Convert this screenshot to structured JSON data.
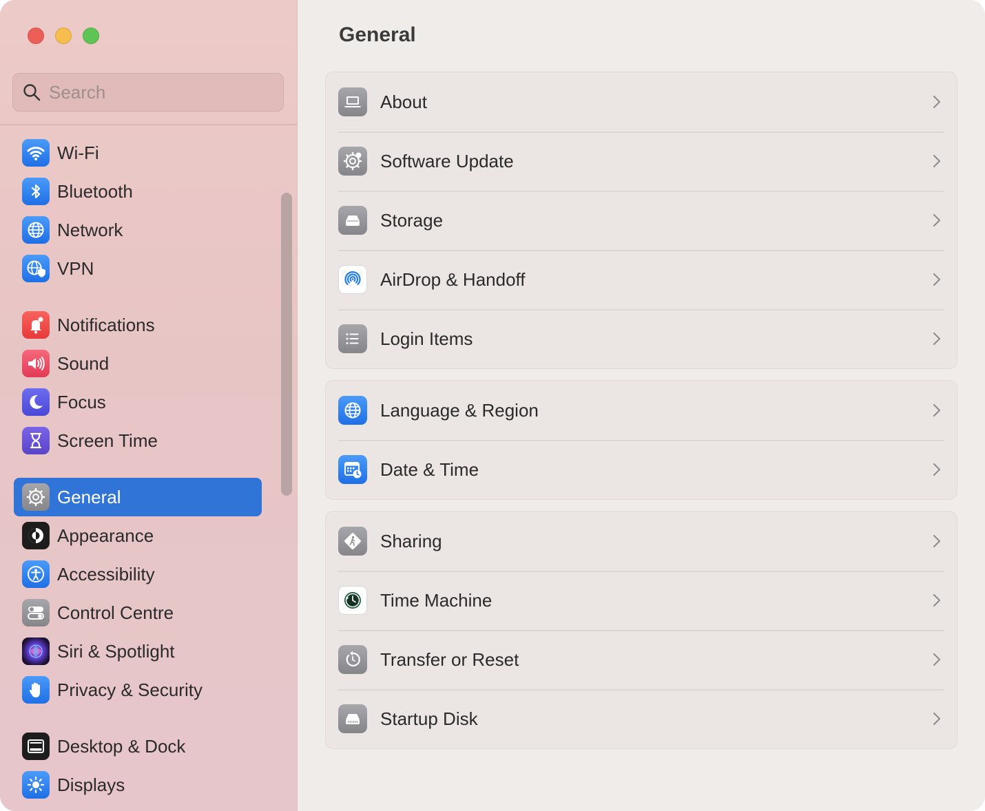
{
  "window": {
    "controls": [
      "close",
      "minimize",
      "zoom"
    ]
  },
  "search": {
    "placeholder": "Search",
    "value": ""
  },
  "sidebar": {
    "items": [
      {
        "label": "Wi-Fi",
        "icon": "wifi-icon",
        "color": "#2f86f5"
      },
      {
        "label": "Bluetooth",
        "icon": "bluetooth-icon",
        "color": "#2f86f5"
      },
      {
        "label": "Network",
        "icon": "globe-icon",
        "color": "#2f86f5"
      },
      {
        "label": "VPN",
        "icon": "vpn-globe-icon",
        "color": "#2f86f5"
      },
      {
        "label": "Notifications",
        "icon": "bell-icon",
        "color": "#ee4a4a"
      },
      {
        "label": "Sound",
        "icon": "speaker-icon",
        "color": "#ee4a5e"
      },
      {
        "label": "Focus",
        "icon": "moon-icon",
        "color": "#5b5ae6"
      },
      {
        "label": "Screen Time",
        "icon": "hourglass-icon",
        "color": "#6a54d8"
      },
      {
        "label": "General",
        "icon": "gear-icon",
        "color": "#8e8e93",
        "selected": true
      },
      {
        "label": "Appearance",
        "icon": "appearance-icon",
        "color": "#1d1d1d"
      },
      {
        "label": "Accessibility",
        "icon": "accessibility-icon",
        "color": "#2f86f5"
      },
      {
        "label": "Control Centre",
        "icon": "toggles-icon",
        "color": "#8e8e93"
      },
      {
        "label": "Siri & Spotlight",
        "icon": "siri-icon",
        "color": "#3a2a6a"
      },
      {
        "label": "Privacy & Security",
        "icon": "hand-icon",
        "color": "#2f86f5"
      },
      {
        "label": "Desktop & Dock",
        "icon": "dock-icon",
        "color": "#1d1d1d"
      },
      {
        "label": "Displays",
        "icon": "sun-icon",
        "color": "#2f86f5"
      }
    ]
  },
  "main": {
    "title": "General",
    "groups": [
      [
        {
          "label": "About",
          "icon": "laptop-icon"
        },
        {
          "label": "Software Update",
          "icon": "gear-badge-icon"
        },
        {
          "label": "Storage",
          "icon": "drive-icon"
        },
        {
          "label": "AirDrop & Handoff",
          "icon": "airdrop-icon"
        },
        {
          "label": "Login Items",
          "icon": "list-icon"
        }
      ],
      [
        {
          "label": "Language & Region",
          "icon": "globe-icon"
        },
        {
          "label": "Date & Time",
          "icon": "calendar-clock-icon"
        }
      ],
      [
        {
          "label": "Sharing",
          "icon": "sharing-icon"
        },
        {
          "label": "Time Machine",
          "icon": "time-machine-icon"
        },
        {
          "label": "Transfer or Reset",
          "icon": "reset-icon"
        },
        {
          "label": "Startup Disk",
          "icon": "startup-disk-icon"
        }
      ]
    ]
  },
  "colors": {
    "accent": "#3174d8",
    "sidebar_bg": "#e8c5c5",
    "content_bg": "#f0ecea"
  }
}
